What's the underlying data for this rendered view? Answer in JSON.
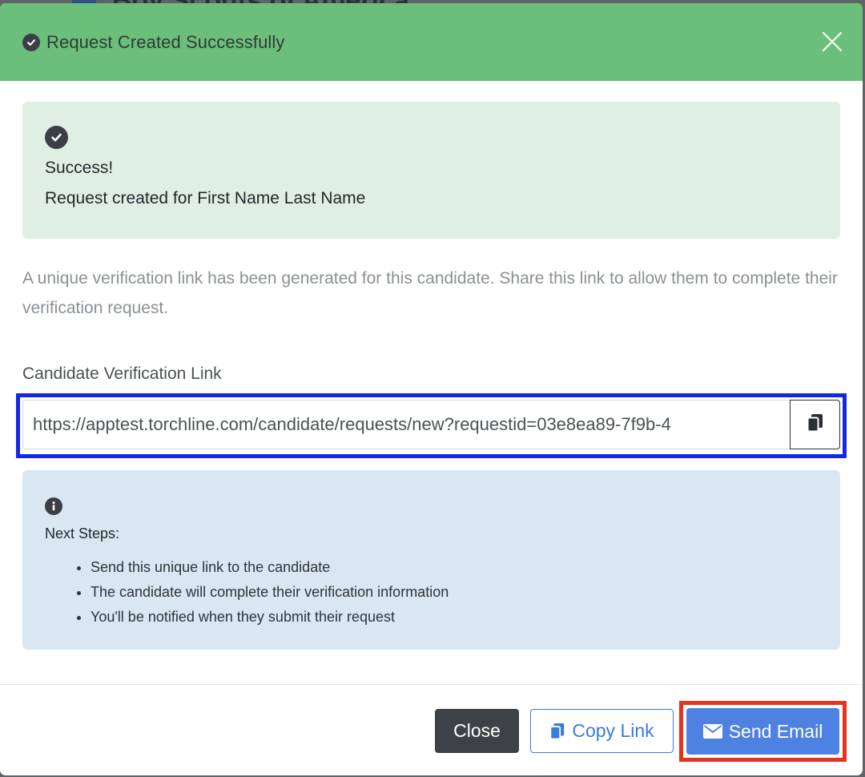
{
  "backdrop": {
    "title": "Boy Scouts of America"
  },
  "header": {
    "title": "Request Created Successfully",
    "icon": "check-circle-icon",
    "close_icon": "close-icon"
  },
  "success_alert": {
    "icon": "check-circle-icon",
    "heading": "Success!",
    "message_prefix": "Request created for ",
    "candidate_name": "First Name Last Name"
  },
  "description": "A unique verification link has been generated for this candidate. Share this link to allow them to complete their verification request.",
  "link_field": {
    "label": "Candidate Verification Link",
    "value": "https://apptest.torchline.com/candidate/requests/new?requestid=03e8ea89-7f9b-4",
    "copy_icon": "copy-icon"
  },
  "info_alert": {
    "icon": "info-circle-icon",
    "title": "Next Steps:",
    "steps": [
      "Send this unique link to the candidate",
      "The candidate will complete their verification information",
      "You'll be notified when they submit their request"
    ]
  },
  "footer": {
    "close_label": "Close",
    "copy_label": "Copy Link",
    "send_label": "Send Email"
  },
  "colors": {
    "header_bg": "#6cbf7b",
    "success_bg": "#e0efe3",
    "info_bg": "#d8e7f1",
    "primary": "#4e82e2",
    "highlight_blue": "#1228e6",
    "highlight_red": "#e8321f"
  }
}
